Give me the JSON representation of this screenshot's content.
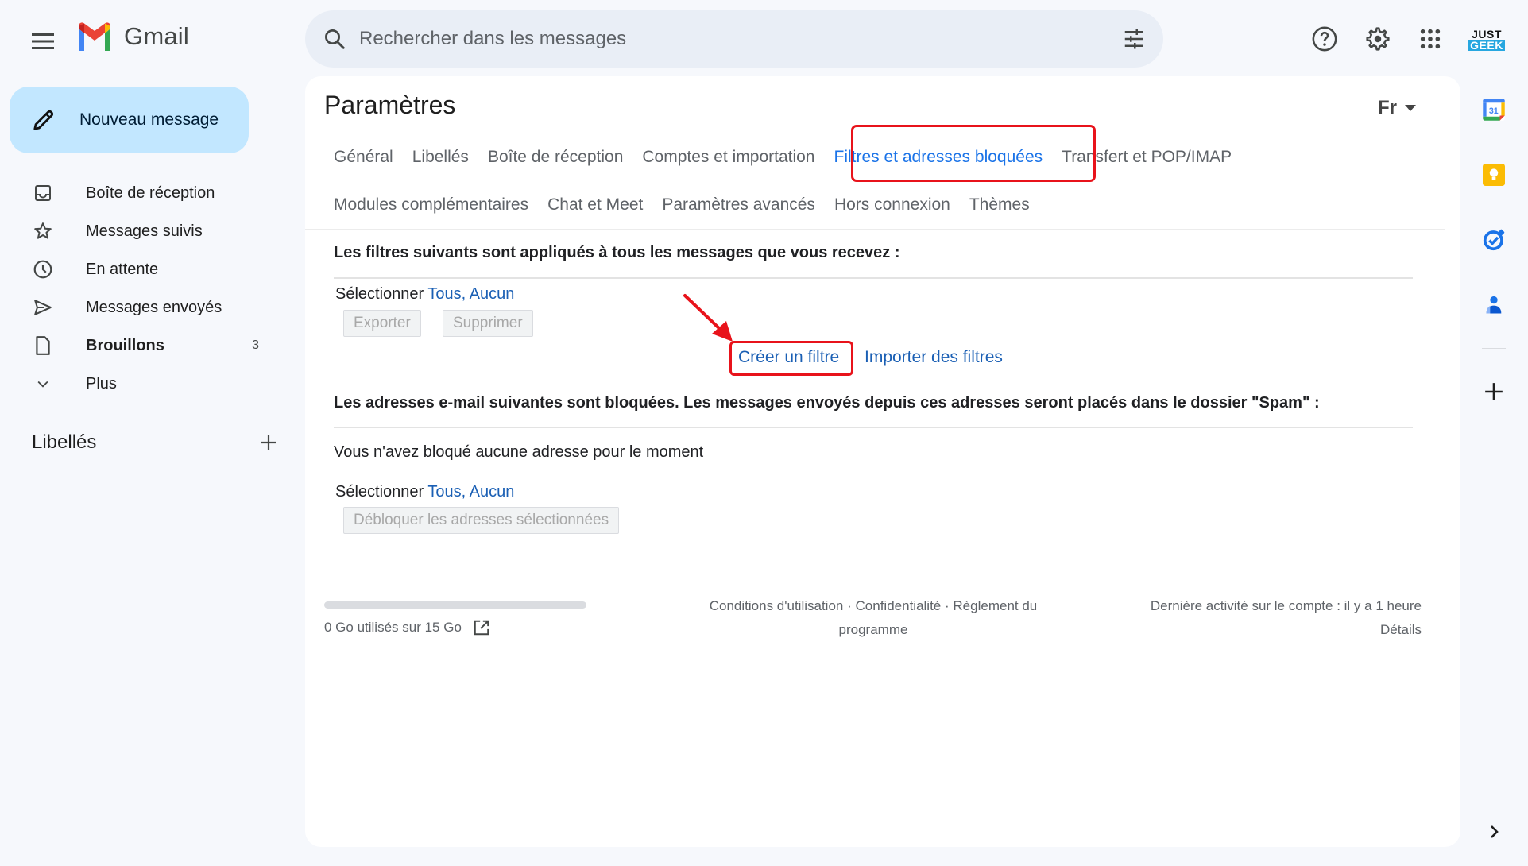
{
  "header": {
    "app_name": "Gmail",
    "search_placeholder": "Rechercher dans les messages",
    "avatar_line1": "JUST",
    "avatar_line2": "GEEK",
    "icons": [
      "menu-icon",
      "search-icon",
      "search-options-icon",
      "help-icon",
      "gear-icon",
      "apps-grid-icon"
    ]
  },
  "compose": {
    "label": "Nouveau message"
  },
  "nav": {
    "items": [
      {
        "label": "Boîte de réception",
        "icon": "inbox-icon",
        "bold": false,
        "count": ""
      },
      {
        "label": "Messages suivis",
        "icon": "star-icon",
        "bold": false,
        "count": ""
      },
      {
        "label": "En attente",
        "icon": "clock-icon",
        "bold": false,
        "count": ""
      },
      {
        "label": "Messages envoyés",
        "icon": "send-icon",
        "bold": false,
        "count": ""
      },
      {
        "label": "Brouillons",
        "icon": "draft-icon",
        "bold": true,
        "count": "3"
      },
      {
        "label": "Plus",
        "icon": "chevron-down-icon",
        "bold": false,
        "count": ""
      }
    ],
    "labels_heading": "Libellés"
  },
  "settings": {
    "title": "Paramètres",
    "language_code": "Fr",
    "tabs_row1": [
      {
        "label": "Général",
        "active": false
      },
      {
        "label": "Libellés",
        "active": false
      },
      {
        "label": "Boîte de réception",
        "active": false
      },
      {
        "label": "Comptes et importation",
        "active": false
      },
      {
        "label": "Filtres et adresses bloquées",
        "active": true
      },
      {
        "label": "Transfert et POP/IMAP",
        "active": false
      }
    ],
    "tabs_row2": [
      {
        "label": "Modules complémentaires",
        "active": false
      },
      {
        "label": "Chat et Meet",
        "active": false
      },
      {
        "label": "Paramètres avancés",
        "active": false
      },
      {
        "label": "Hors connexion",
        "active": false
      },
      {
        "label": "Thèmes",
        "active": false
      }
    ],
    "filters": {
      "heading": "Les filtres suivants sont appliqués à tous les messages que vous recevez :",
      "select_prefix": "Sélectionner",
      "select_all": "Tous",
      "select_sep": ",",
      "select_none": "Aucun",
      "export_button": "Exporter",
      "delete_button": "Supprimer",
      "create_filter": "Créer un filtre",
      "import_filters": "Importer des filtres"
    },
    "blocked": {
      "heading": "Les adresses e-mail suivantes sont bloquées. Les messages envoyés depuis ces adresses seront placés dans le dossier \"Spam\" :",
      "empty_message": "Vous n'avez bloqué aucune adresse pour le moment",
      "select_prefix": "Sélectionner",
      "select_all": "Tous",
      "select_sep": ",",
      "select_none": "Aucun",
      "unblock_button": "Débloquer les adresses sélectionnées"
    }
  },
  "footer": {
    "storage_text": "0 Go utilisés sur 15 Go",
    "storage_used_fraction": 0,
    "terms": "Conditions d'utilisation",
    "privacy": "Confidentialité",
    "program_policy_1": "Règlement du",
    "program_policy_2": "programme",
    "separator": "·",
    "last_activity": "Dernière activité sur le compte : il y a 1 heure",
    "details": "Détails"
  },
  "annotations": {
    "highlight_color": "#e8131b"
  },
  "colors": {
    "accent": "#1a73e8",
    "link": "#1a5fb4",
    "compose_bg": "#c2e7ff",
    "search_bg": "#e9eef6",
    "page_bg": "#f6f8fc"
  },
  "right_rail": [
    "calendar-icon",
    "keep-icon",
    "tasks-icon",
    "contacts-icon",
    "add-addon-icon",
    "expand-panel-icon"
  ]
}
